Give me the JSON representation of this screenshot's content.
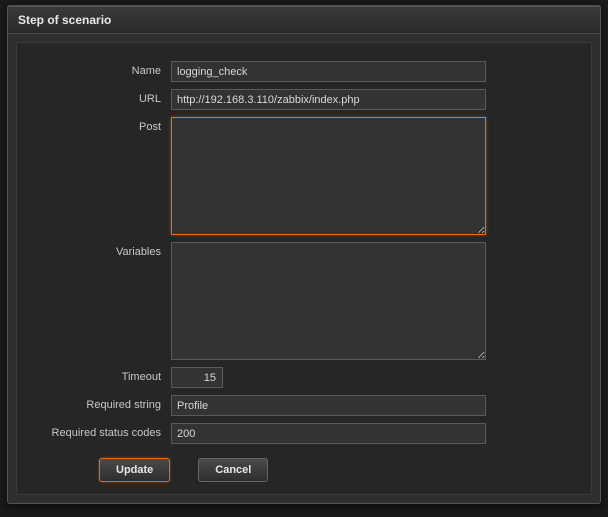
{
  "dialog": {
    "title": "Step of scenario"
  },
  "form": {
    "name_label": "Name",
    "name_value": "logging_check",
    "url_label": "URL",
    "url_value": "http://192.168.3.110/zabbix/index.php",
    "post_label": "Post",
    "post_value": "",
    "variables_label": "Variables",
    "variables_value": "",
    "timeout_label": "Timeout",
    "timeout_value": "15",
    "required_string_label": "Required string",
    "required_string_value": "Profile",
    "required_status_codes_label": "Required status codes",
    "required_status_codes_value": "200"
  },
  "buttons": {
    "update": "Update",
    "cancel": "Cancel"
  }
}
